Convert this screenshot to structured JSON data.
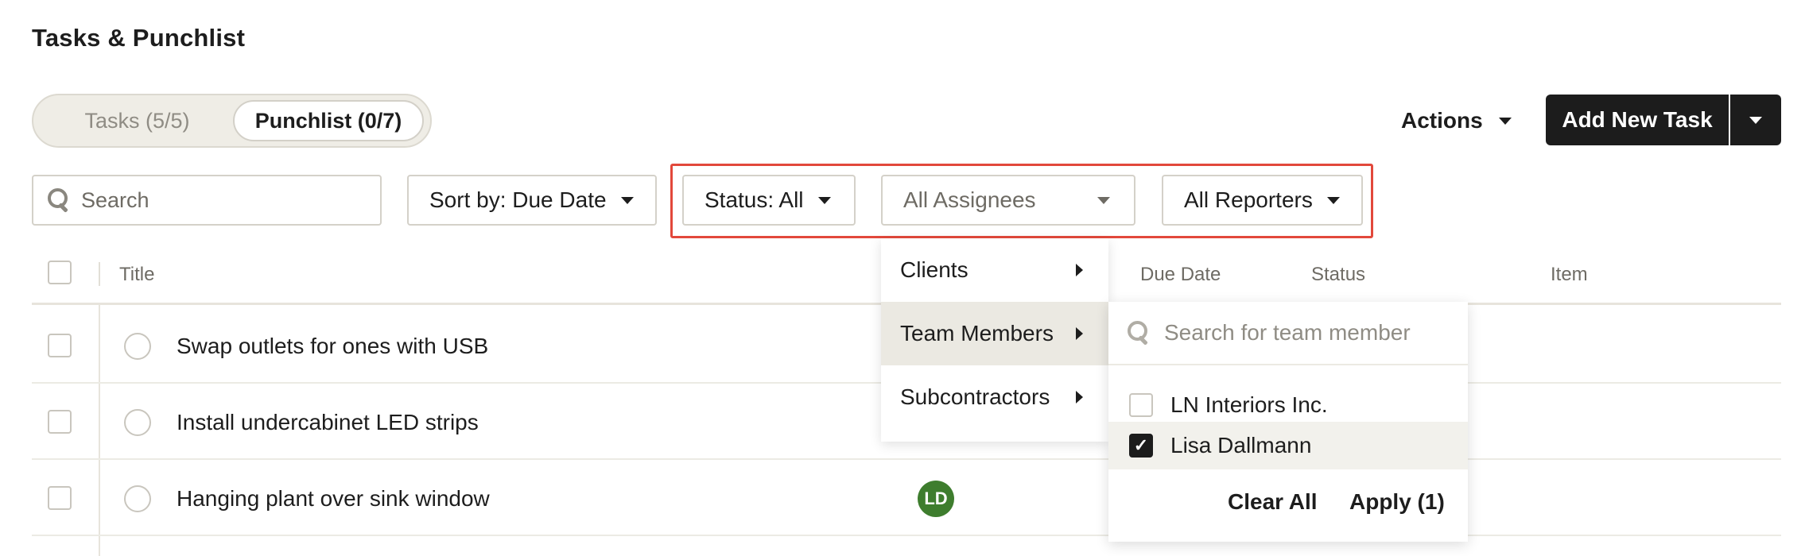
{
  "page": {
    "title": "Tasks & Punchlist"
  },
  "tabs": [
    {
      "label": "Tasks (5/5)",
      "active": false
    },
    {
      "label": "Punchlist (0/7)",
      "active": true
    }
  ],
  "toolbar": {
    "actions_label": "Actions",
    "add_label": "Add New Task"
  },
  "filters": {
    "search_placeholder": "Search",
    "sort_label": "Sort by: Due Date",
    "status_label": "Status: All",
    "assignees_label": "All Assignees",
    "reporters_label": "All Reporters"
  },
  "table": {
    "headers": {
      "title": "Title",
      "due_date": "Due Date",
      "status": "Status",
      "item": "Item"
    },
    "rows": [
      {
        "title": "Swap outlets for ones with USB",
        "assignee": ""
      },
      {
        "title": "Install undercabinet LED strips",
        "assignee": ""
      },
      {
        "title": "Hanging plant over sink window",
        "assignee": "LD"
      }
    ]
  },
  "assignee_menu": {
    "categories": [
      {
        "label": "Clients"
      },
      {
        "label": "Team Members",
        "highlighted": true
      },
      {
        "label": "Subcontractors"
      }
    ],
    "team_members": {
      "search_placeholder": "Search for team member",
      "options": [
        {
          "label": "LN Interiors Inc.",
          "checked": false
        },
        {
          "label": "Lisa Dallmann",
          "checked": true
        }
      ],
      "clear_label": "Clear All",
      "apply_label": "Apply (1)"
    }
  },
  "colors": {
    "highlight": "#e2483b",
    "primary_button": "#1c1c1c",
    "avatar": "#3e7d2e"
  }
}
